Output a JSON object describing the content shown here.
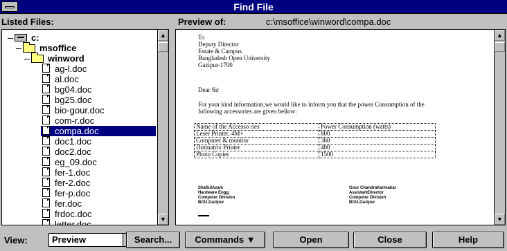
{
  "window": {
    "title": "Find File"
  },
  "labels": {
    "listed_files": "Listed Files:",
    "preview_of": "Preview of:",
    "preview_path": "c:\\msoffice\\winword\\compa.doc"
  },
  "tree": {
    "drive": "c:",
    "folders": [
      "msoffice",
      "winword"
    ],
    "files": [
      "ag-l.doc",
      "al.doc",
      "bg04.doc",
      "bg25.doc",
      "bio-gour.doc",
      "com-r.doc",
      "compa.doc",
      "doc1.doc",
      "doc2.doc",
      "eg_09.doc",
      "fer-1.doc",
      "fer-2.doc",
      "fer-p.doc",
      "fer.doc",
      "frdoc.doc",
      "letter.doc"
    ],
    "selected": "compa.doc"
  },
  "preview": {
    "address_lines": [
      "To",
      "Deputy Director",
      "Estate & Campus",
      "Bangladesh Open University",
      "Gazipur-1700"
    ],
    "salutation": "Dear Sir",
    "body_lines": [
      "For your kind information,we would like to inform you that the power Consumption of the",
      "following accessories are given bellow:"
    ],
    "table": [
      [
        "Name of the Accesso ries",
        "Power Consumption (watts)"
      ],
      [
        "Leser Printer, 4M+",
        "800"
      ],
      [
        "Computer & monitor",
        "360"
      ],
      [
        "Dotmatrix Printer",
        "400"
      ],
      [
        "Photo Copier",
        "1500"
      ]
    ],
    "signature_left": [
      "ShafiulAzam",
      "Hardware Engg.",
      "Computer Division",
      "BOU,Gazipur"
    ],
    "signature_right": [
      "Gour ChandraKarmakar",
      "AssistantDirector",
      "Computer Division",
      "BOU,Gazipur"
    ]
  },
  "bottom": {
    "view_label": "View:",
    "view_value": "Preview",
    "buttons": {
      "search": "Search...",
      "commands": "Commands",
      "open": "Open",
      "close": "Close",
      "help": "Help"
    }
  }
}
